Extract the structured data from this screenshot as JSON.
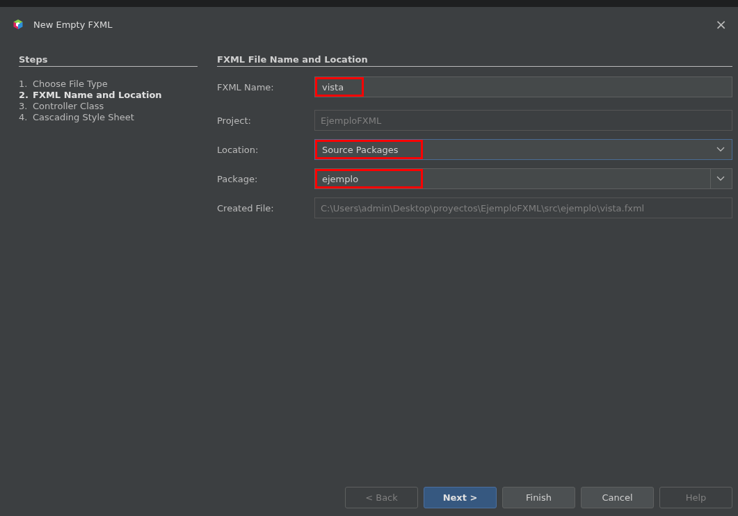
{
  "window": {
    "title": "New Empty FXML",
    "close": "×"
  },
  "steps": {
    "title": "Steps",
    "items": [
      {
        "number": "1.",
        "label": "Choose File Type",
        "selected": false
      },
      {
        "number": "2.",
        "label": "FXML Name and Location",
        "selected": true
      },
      {
        "number": "3.",
        "label": "Controller Class",
        "selected": false
      },
      {
        "number": "4.",
        "label": "Cascading Style Sheet",
        "selected": false
      }
    ]
  },
  "form": {
    "title": "FXML File Name and Location",
    "fields": [
      {
        "kind": "text",
        "label": "FXML Name:",
        "value": "vista",
        "disabled": false,
        "highlighted": true,
        "focused": false
      },
      {
        "kind": "text",
        "label": "Project:",
        "value": "EjemploFXML",
        "disabled": true,
        "highlighted": false,
        "focused": false
      },
      {
        "kind": "select",
        "label": "Location:",
        "value": "Source Packages",
        "disabled": false,
        "highlighted": true,
        "focused": true
      },
      {
        "kind": "combo",
        "label": "Package:",
        "value": "ejemplo",
        "disabled": false,
        "highlighted": true,
        "focused": false
      },
      {
        "kind": "text",
        "label": "Created File:",
        "value": "C:\\Users\\admin\\Desktop\\proyectos\\EjemploFXML\\src\\ejemplo\\vista.fxml",
        "disabled": true,
        "highlighted": false,
        "focused": false
      }
    ]
  },
  "buttons": [
    {
      "label": "< Back",
      "disabled": true,
      "default": false
    },
    {
      "label": "Next >",
      "disabled": false,
      "default": true
    },
    {
      "label": "Finish",
      "disabled": false,
      "default": false
    },
    {
      "label": "Cancel",
      "disabled": false,
      "default": false
    },
    {
      "label": "Help",
      "disabled": true,
      "default": false
    }
  ]
}
